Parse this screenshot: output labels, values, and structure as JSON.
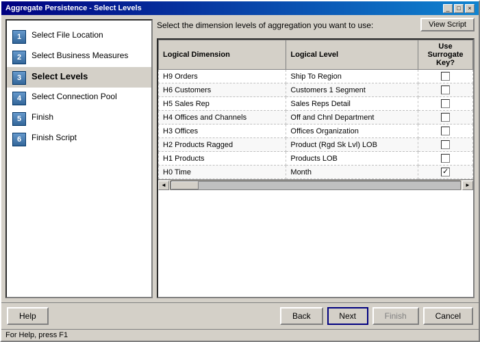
{
  "window": {
    "title": "Aggregate Persistence - Select Levels",
    "title_btns": [
      "_",
      "□",
      "×"
    ]
  },
  "instructions": "Select the dimension levels of aggregation you want to use:",
  "view_script_btn": "View Script",
  "sidebar": {
    "steps": [
      {
        "num": "1",
        "label": "Select File Location",
        "active": false
      },
      {
        "num": "2",
        "label": "Select Business Measures",
        "active": false
      },
      {
        "num": "3",
        "label": "Select Levels",
        "active": true
      },
      {
        "num": "4",
        "label": "Select Connection Pool",
        "active": false
      },
      {
        "num": "5",
        "label": "Finish",
        "active": false
      },
      {
        "num": "6",
        "label": "Finish Script",
        "active": false
      }
    ]
  },
  "table": {
    "columns": [
      "Logical Dimension",
      "Logical Level",
      "Use Surrogate Key?"
    ],
    "rows": [
      {
        "dimension": "H9 Orders",
        "level": "Ship To Region",
        "checked": false
      },
      {
        "dimension": "H6 Customers",
        "level": "Customers 1 Segment",
        "checked": false
      },
      {
        "dimension": "H5 Sales Rep",
        "level": "Sales Reps Detail",
        "checked": false
      },
      {
        "dimension": "H4 Offices and Channels",
        "level": "Off and Chnl Department",
        "checked": false
      },
      {
        "dimension": "H3 Offices",
        "level": "Offices Organization",
        "checked": false
      },
      {
        "dimension": "H2 Products Ragged",
        "level": "Product (Rgd Sk Lvl) LOB",
        "checked": false
      },
      {
        "dimension": "H1 Products",
        "level": "Products LOB",
        "checked": false
      },
      {
        "dimension": "H0 Time",
        "level": "Month",
        "checked": true
      }
    ]
  },
  "buttons": {
    "help": "Help",
    "back": "Back",
    "next": "Next",
    "finish": "Finish",
    "cancel": "Cancel"
  },
  "status": "For Help, press F1",
  "scroll_arrows": {
    "left": "◄",
    "right": "►"
  }
}
